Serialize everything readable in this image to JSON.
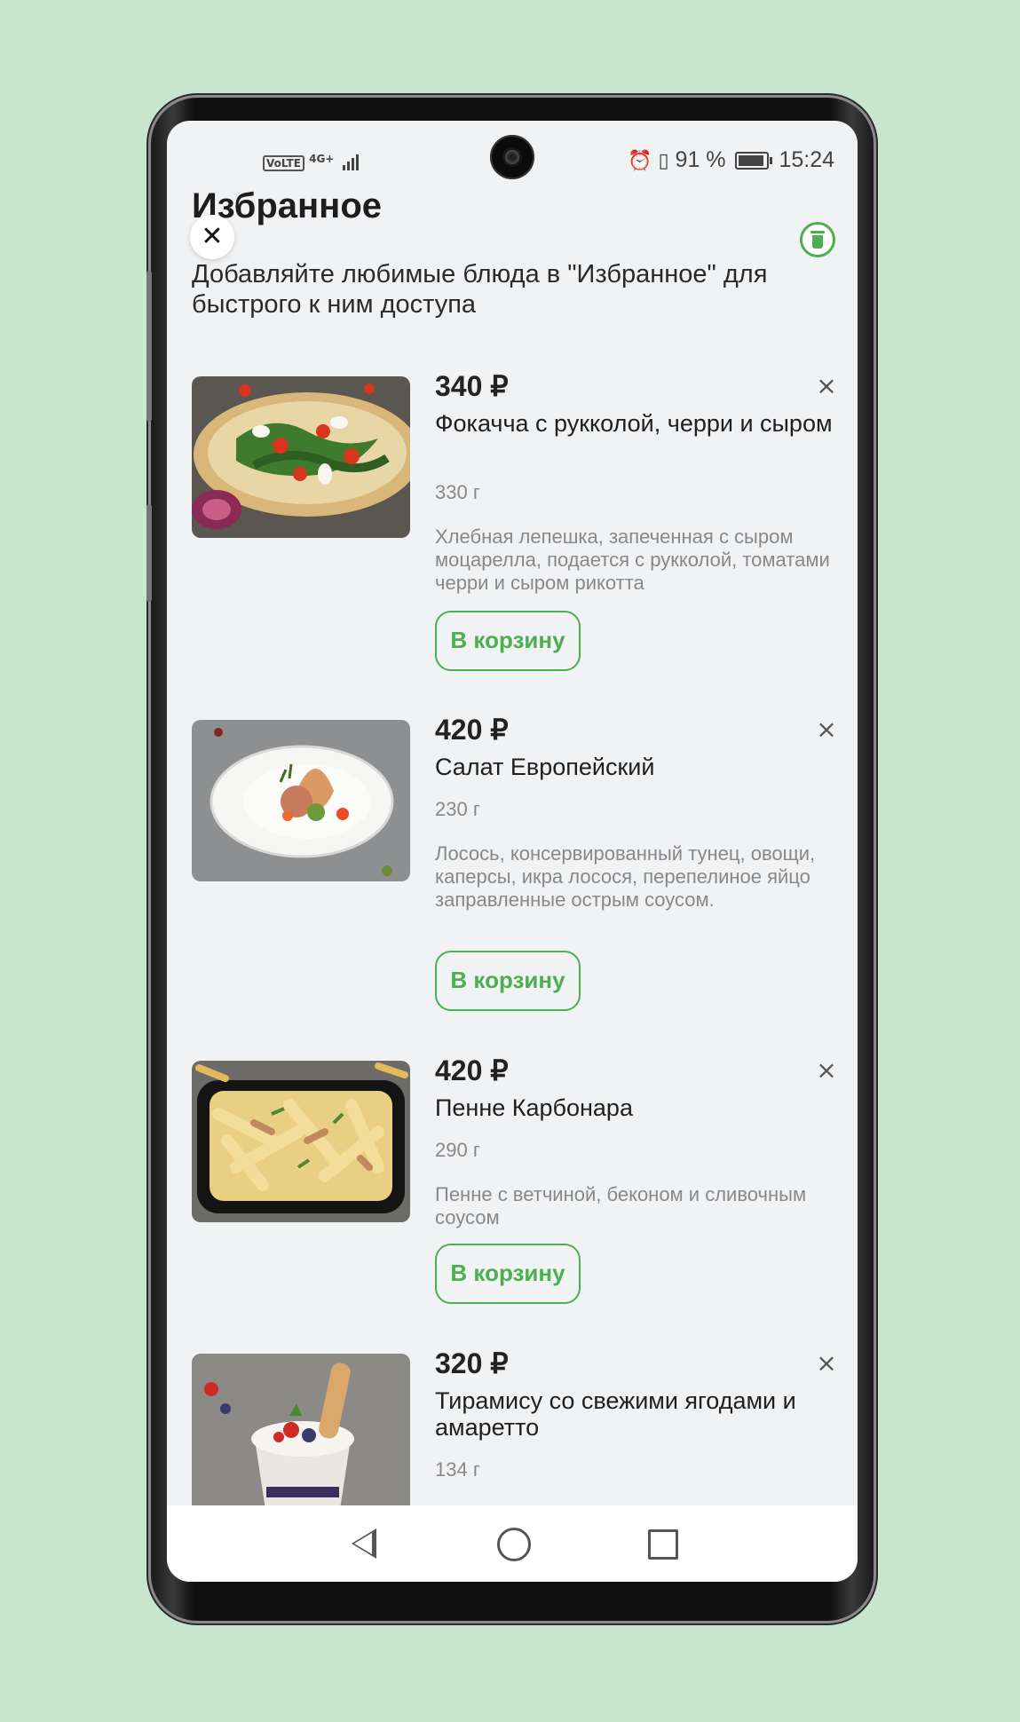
{
  "status_bar": {
    "network": "VoLTE",
    "mobile": "4G+",
    "battery": "91 %",
    "time": "15:24"
  },
  "header": {
    "title": "Избранное",
    "subtitle": "Добавляйте любимые блюда в \"Избранное\" для быстрого к ним доступа"
  },
  "items": [
    {
      "price": "340 ₽",
      "name": "Фокачча с рукколой, черри и сыром",
      "weight": "330 г",
      "description": "Хлебная лепешка, запеченная с сыром моцарелла, подается с рукколой, томатами черри и сыром рикотта",
      "cart_label": "В корзину",
      "remove": "×"
    },
    {
      "price": "420 ₽",
      "name": "Салат Европейский",
      "weight": "230 г",
      "description": "Лосось, консервированный тунец, овощи, каперсы, икра лосося, перепелиное яйцо заправленные острым соусом.",
      "cart_label": "В корзину",
      "remove": "×"
    },
    {
      "price": "420 ₽",
      "name": "Пенне Карбонара",
      "weight": "290 г",
      "description": "Пенне с ветчиной, беконом и сливочным соусом",
      "cart_label": "В корзину",
      "remove": "×"
    },
    {
      "price": "320 ₽",
      "name": "Тирамису со свежими ягодами и амаретто",
      "weight": "134 г",
      "remove": "×"
    }
  ],
  "colors": {
    "accent": "#4caf50",
    "background": "#f1f2f4",
    "outer": "#c8e6cd"
  },
  "icons": {
    "close": "close-icon",
    "delete_all": "trash-icon",
    "remove_item": "close-icon",
    "nav_back": "back-icon",
    "nav_home": "home-icon",
    "nav_recent": "recent-apps-icon"
  }
}
